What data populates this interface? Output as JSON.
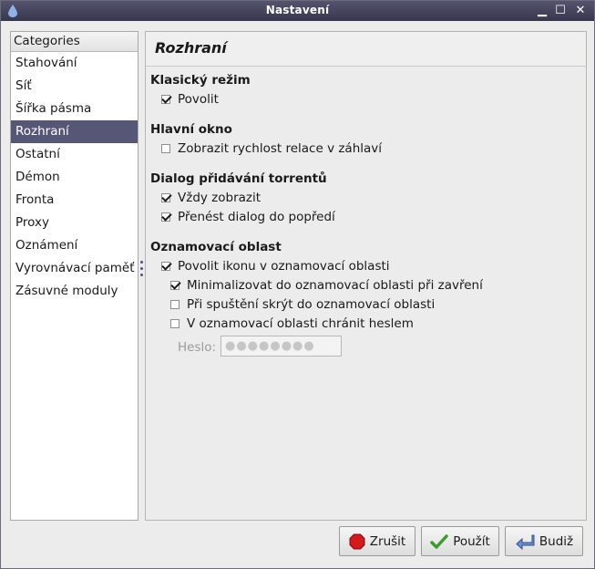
{
  "window": {
    "title": "Nastavení"
  },
  "categories": {
    "header": "Categories",
    "items": [
      "Stahování",
      "Síť",
      "Šířka pásma",
      "Rozhraní",
      "Ostatní",
      "Démon",
      "Fronta",
      "Proxy",
      "Oznámení",
      "Vyrovnávací paměť",
      "Zásuvné moduly"
    ],
    "selected": "Rozhraní"
  },
  "panel": {
    "title": "Rozhraní",
    "classic": {
      "heading": "Klasický režim",
      "enable": "Povolit"
    },
    "main_window": {
      "heading": "Hlavní okno",
      "show_speed": "Zobrazit rychlost relace v záhlaví"
    },
    "add_dialog": {
      "heading": "Dialog přidávání torrentů",
      "always_show": "Vždy zobrazit",
      "bring_front": "Přenést dialog do popředí"
    },
    "tray": {
      "heading": "Oznamovací oblast",
      "enable_icon": "Povolit ikonu v oznamovací oblasti",
      "minimize": "Minimalizovat do oznamovací oblasti při zavření",
      "start_hidden": "Při spuštění skrýt do oznamovací oblasti",
      "protect": "V oznamovací oblasti chránit heslem",
      "password_label": "Heslo:",
      "password_value": "●●●●●●●●"
    }
  },
  "checks": {
    "classic_enable": true,
    "show_speed": false,
    "always_show": true,
    "bring_front": true,
    "enable_icon": true,
    "minimize": true,
    "start_hidden": false,
    "protect": false
  },
  "buttons": {
    "cancel": "Zrušit",
    "apply": "Použít",
    "ok": "Budiž"
  },
  "colors": {
    "selected_bg": "#565677",
    "titlebar": "#45455d"
  }
}
